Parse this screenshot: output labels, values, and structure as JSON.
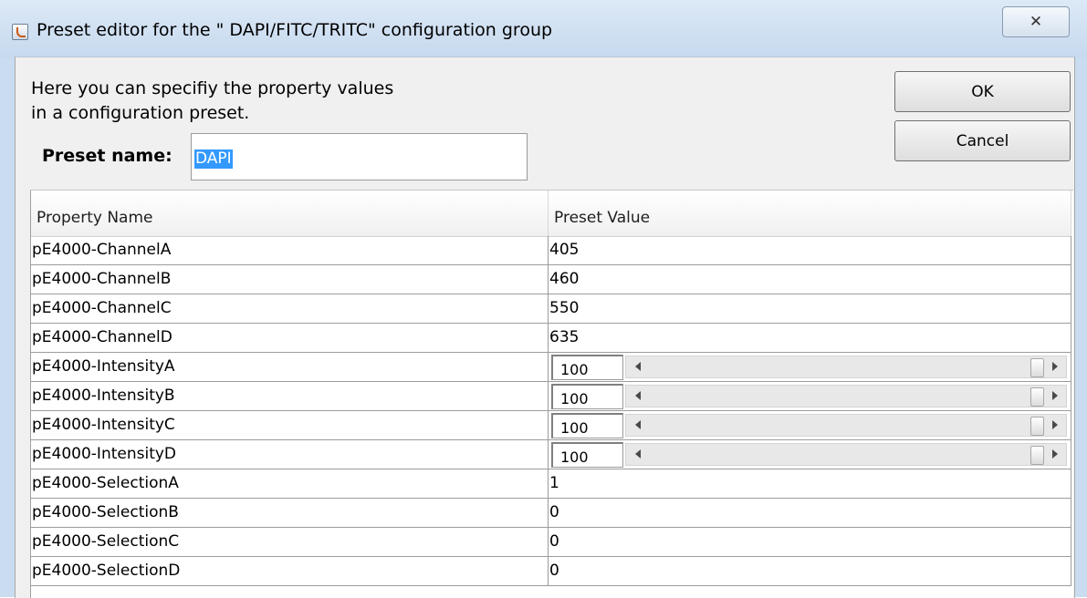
{
  "window": {
    "title": "Preset editor for the \" DAPI/FITC/TRITC\" configuration group",
    "close_label": "✕"
  },
  "instructions": {
    "line1": "Here you can specifiy the property values",
    "line2": "in a configuration preset."
  },
  "preset": {
    "label": "Preset name:",
    "value": "DAPI"
  },
  "buttons": {
    "ok": "OK",
    "cancel": "Cancel"
  },
  "table": {
    "headers": [
      "Property Name",
      "Preset Value"
    ],
    "rows": [
      {
        "name": "pE4000-ChannelA",
        "value": "405",
        "kind": "text"
      },
      {
        "name": "pE4000-ChannelB",
        "value": "460",
        "kind": "text"
      },
      {
        "name": "pE4000-ChannelC",
        "value": "550",
        "kind": "text"
      },
      {
        "name": "pE4000-ChannelD",
        "value": "635",
        "kind": "text"
      },
      {
        "name": "pE4000-IntensityA",
        "value": "100",
        "kind": "slider",
        "level": 1.0
      },
      {
        "name": "pE4000-IntensityB",
        "value": "100",
        "kind": "slider",
        "level": 1.0
      },
      {
        "name": "pE4000-IntensityC",
        "value": "100",
        "kind": "slider",
        "level": 1.0
      },
      {
        "name": "pE4000-IntensityD",
        "value": "100",
        "kind": "slider",
        "level": 1.0
      },
      {
        "name": "pE4000-SelectionA",
        "value": "1",
        "kind": "text"
      },
      {
        "name": "pE4000-SelectionB",
        "value": "0",
        "kind": "text"
      },
      {
        "name": "pE4000-SelectionC",
        "value": "0",
        "kind": "text"
      },
      {
        "name": "pE4000-SelectionD",
        "value": "0",
        "kind": "text"
      }
    ]
  }
}
